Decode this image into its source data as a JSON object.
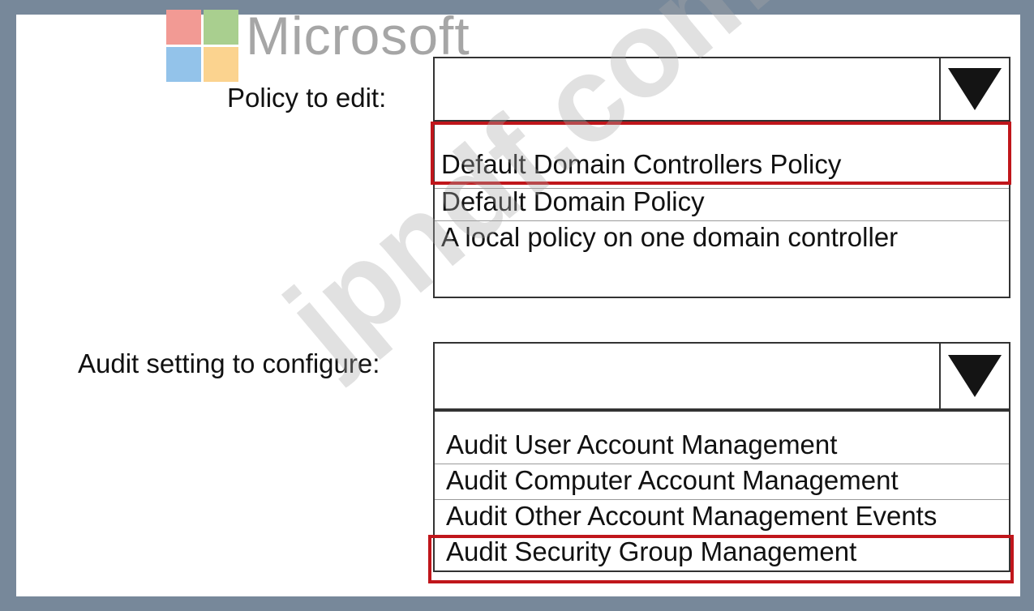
{
  "logo": {
    "wordmark": "Microsoft"
  },
  "watermark": "jpndf.com",
  "policy": {
    "label": "Policy to edit:",
    "selected": "",
    "options": [
      "Default Domain Controllers Policy",
      "Default Domain Policy",
      "A local policy on one domain controller"
    ],
    "highlighted_option": "Default Domain Controllers Policy"
  },
  "audit": {
    "label": "Audit setting to configure:",
    "selected": "",
    "options": [
      "Audit User Account Management",
      "Audit Computer Account Management",
      "Audit Other Account Management Events",
      "Audit Security Group Management"
    ],
    "highlighted_option": "Audit Security Group Management"
  },
  "colors": {
    "highlight": "#c0161b",
    "frame": "#77889a"
  },
  "icons": {
    "dropdown": "dropdown-triangle-icon"
  }
}
